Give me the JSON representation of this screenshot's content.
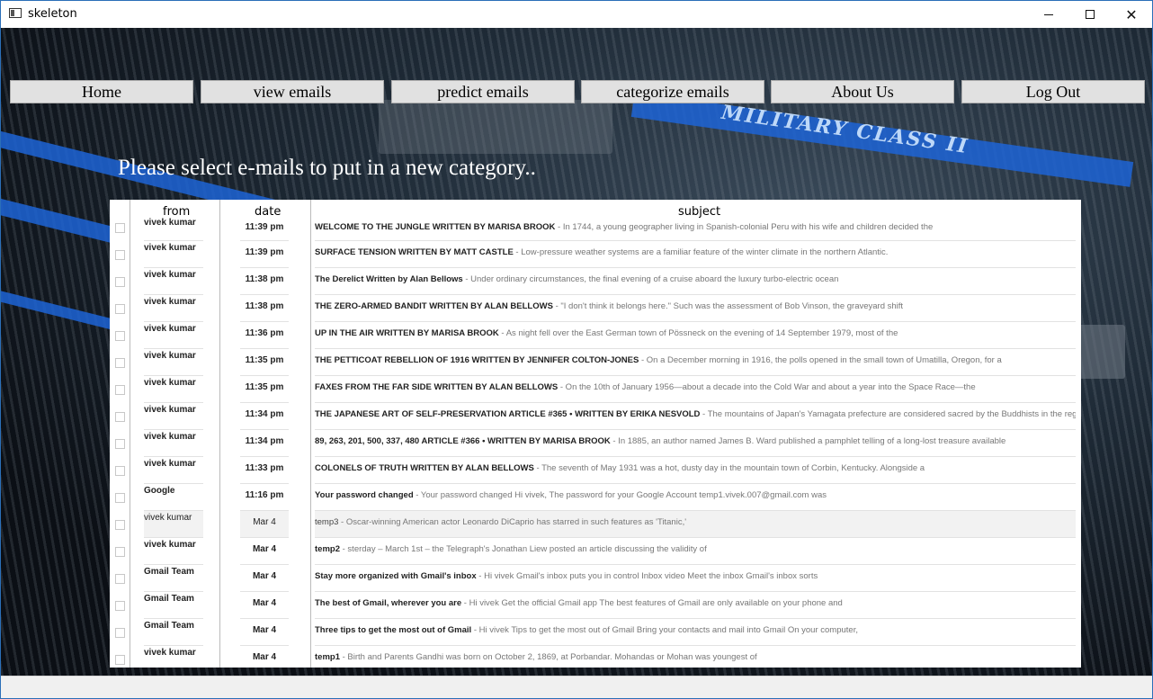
{
  "window": {
    "title": "skeleton"
  },
  "background": {
    "board_label": "MILITARY CLASS II"
  },
  "nav": {
    "items": [
      {
        "label": "Home"
      },
      {
        "label": "view emails"
      },
      {
        "label": "predict emails"
      },
      {
        "label": "categorize emails"
      },
      {
        "label": "About Us"
      },
      {
        "label": "Log Out"
      }
    ]
  },
  "prompt": "Please select e-mails to put in a new category..",
  "table": {
    "headers": {
      "from": "from",
      "date": "date",
      "subject": "subject"
    },
    "rows": [
      {
        "from": "vivek kumar",
        "date": "11:39 pm",
        "title": "WELCOME TO THE JUNGLE WRITTEN BY MARISA BROOK",
        "snippet": " - In 1744, a young geographer living in Spanish-colonial Peru with his wife and children decided the"
      },
      {
        "from": "vivek kumar",
        "date": "11:39 pm",
        "title": "SURFACE TENSION WRITTEN BY MATT CASTLE",
        "snippet": " - Low-pressure weather systems are a familiar feature of the winter climate in the northern Atlantic."
      },
      {
        "from": "vivek kumar",
        "date": "11:38 pm",
        "title": "The Derelict Written by Alan Bellows",
        "snippet": " - Under ordinary circumstances, the final evening of a cruise aboard the luxury turbo-electric ocean"
      },
      {
        "from": "vivek kumar",
        "date": "11:38 pm",
        "title": "THE ZERO-ARMED BANDIT WRITTEN BY ALAN BELLOWS",
        "snippet": " - \"I don't think it belongs here.\" Such was the assessment of Bob Vinson, the graveyard shift"
      },
      {
        "from": "vivek kumar",
        "date": "11:36 pm",
        "title": "UP IN THE AIR WRITTEN BY MARISA BROOK",
        "snippet": " - As night fell over the East German town of Pössneck on the evening of 14 September 1979, most of the"
      },
      {
        "from": "vivek kumar",
        "date": "11:35 pm",
        "title": "THE PETTICOAT REBELLION OF 1916 WRITTEN BY JENNIFER COLTON-JONES",
        "snippet": " - On a December morning in 1916, the polls opened in the small town of Umatilla, Oregon, for a"
      },
      {
        "from": "vivek kumar",
        "date": "11:35 pm",
        "title": "FAXES FROM THE FAR SIDE WRITTEN BY ALAN BELLOWS",
        "snippet": " - On the 10th of January 1956—about a decade into the Cold War and about a year into the Space Race—the"
      },
      {
        "from": "vivek kumar",
        "date": "11:34 pm",
        "title": "THE JAPANESE ART OF SELF-PRESERVATION ARTICLE #365 • WRITTEN BY ERIKA NESVOLD",
        "snippet": " - The mountains of Japan's Yamagata prefecture are considered sacred by the Buddhists in the reg"
      },
      {
        "from": "vivek kumar",
        "date": "11:34 pm",
        "title": "89, 263, 201, 500, 337, 480 ARTICLE #366 • WRITTEN BY MARISA BROOK",
        "snippet": " - In 1885, an author named James B. Ward published a pamphlet telling of a long-lost treasure available"
      },
      {
        "from": "vivek kumar",
        "date": "11:33 pm",
        "title": "COLONELS OF TRUTH WRITTEN BY ALAN BELLOWS",
        "snippet": " - The seventh of May 1931 was a hot, dusty day in the mountain town of Corbin, Kentucky. Alongside a"
      },
      {
        "from": "Google",
        "date": "11:16 pm",
        "title": "Your password changed",
        "snippet": " - Your password changed Hi vivek, The password for your Google Account temp1.vivek.007@gmail.com was"
      },
      {
        "from": "vivek kumar",
        "date": "Mar 4",
        "title": "temp3",
        "snippet": " - Oscar-winning American actor Leonardo DiCaprio has starred in such features as 'Titanic,'",
        "read": true
      },
      {
        "from": "vivek kumar",
        "date": "Mar 4",
        "title": "temp2",
        "snippet": " - sterday – March 1st – the Telegraph's Jonathan Liew posted an article discussing the validity of"
      },
      {
        "from": "Gmail Team",
        "date": "Mar 4",
        "title": "Stay more organized with Gmail's inbox",
        "snippet": " - Hi vivek Gmail's inbox puts you in control Inbox video Meet the inbox Gmail's inbox sorts"
      },
      {
        "from": "Gmail Team",
        "date": "Mar 4",
        "title": "The best of Gmail, wherever you are",
        "snippet": " - Hi vivek Get the official Gmail app The best features of Gmail are only available on your phone and"
      },
      {
        "from": "Gmail Team",
        "date": "Mar 4",
        "title": "Three tips to get the most out of Gmail",
        "snippet": " - Hi vivek Tips to get the most out of Gmail Bring your contacts and mail into Gmail On your computer,"
      },
      {
        "from": "vivek kumar",
        "date": "Mar 4",
        "title": "temp1",
        "snippet": " - Birth and Parents Gandhi was born on October 2, 1869, at Porbandar. Mohandas or Mohan was youngest of"
      }
    ]
  }
}
